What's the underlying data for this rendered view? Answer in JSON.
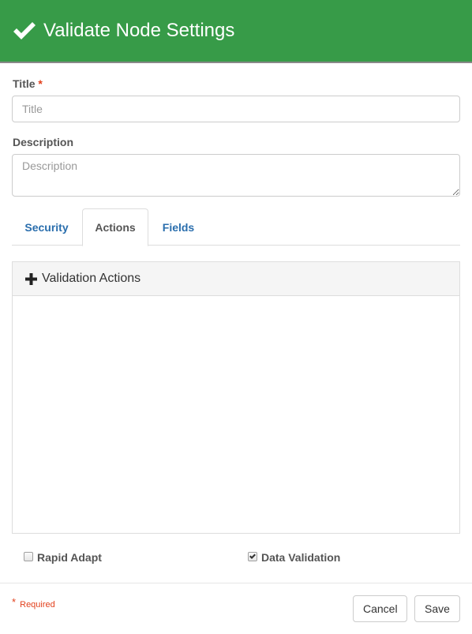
{
  "header": {
    "icon": "check-icon",
    "title": "Validate Node Settings",
    "color": "#379b48"
  },
  "form": {
    "title_label": "Title",
    "required_marker": "*",
    "title_placeholder": "Title",
    "title_value": "",
    "description_label": "Description",
    "description_placeholder": "Description",
    "description_value": ""
  },
  "tabs": [
    {
      "label": "Security",
      "active": false
    },
    {
      "label": "Actions",
      "active": true
    },
    {
      "label": "Fields",
      "active": false
    }
  ],
  "panel": {
    "icon": "plus-icon",
    "heading": "Validation Actions",
    "items": []
  },
  "options": {
    "rapid_adapt": {
      "label": "Rapid Adapt",
      "checked": false
    },
    "data_validation": {
      "label": "Data Validation",
      "checked": true
    }
  },
  "footer": {
    "required_marker": "*",
    "required_note": "Required",
    "cancel_label": "Cancel",
    "save_label": "Save"
  }
}
